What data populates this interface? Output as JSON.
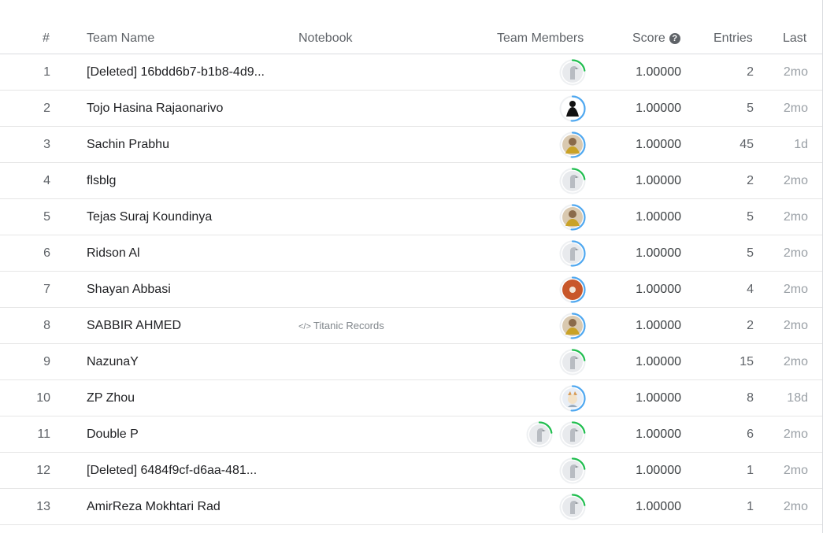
{
  "headers": {
    "rank": "#",
    "team_name": "Team Name",
    "notebook": "Notebook",
    "team_members": "Team Members",
    "score": "Score",
    "entries": "Entries",
    "last": "Last"
  },
  "colors": {
    "ring_green": "#20BE4F",
    "ring_blue": "#4FA8F0",
    "default_avatar": "#9aa0a6"
  },
  "rows": [
    {
      "rank": "1",
      "team": "[Deleted] 16bdd6b7-b1b8-4d9...",
      "notebook": "",
      "members": [
        {
          "icon": "goose-avatar-icon",
          "ring": "green"
        }
      ],
      "score": "1.00000",
      "entries": "2",
      "last": "2mo"
    },
    {
      "rank": "2",
      "team": "Tojo Hasina Rajaonarivo",
      "notebook": "",
      "members": [
        {
          "icon": "silhouette-avatar-icon",
          "ring": "blue"
        }
      ],
      "score": "1.00000",
      "entries": "5",
      "last": "2mo"
    },
    {
      "rank": "3",
      "team": "Sachin Prabhu",
      "notebook": "",
      "members": [
        {
          "icon": "photo-avatar-icon",
          "ring": "blue"
        }
      ],
      "score": "1.00000",
      "entries": "45",
      "last": "1d"
    },
    {
      "rank": "4",
      "team": "flsblg",
      "notebook": "",
      "members": [
        {
          "icon": "goose-avatar-icon",
          "ring": "green"
        }
      ],
      "score": "1.00000",
      "entries": "2",
      "last": "2mo"
    },
    {
      "rank": "5",
      "team": "Tejas Suraj Koundinya",
      "notebook": "",
      "members": [
        {
          "icon": "photo-avatar-icon",
          "ring": "blue"
        }
      ],
      "score": "1.00000",
      "entries": "5",
      "last": "2mo"
    },
    {
      "rank": "6",
      "team": "Ridson Al",
      "notebook": "",
      "members": [
        {
          "icon": "goose-avatar-icon",
          "ring": "blue"
        }
      ],
      "score": "1.00000",
      "entries": "5",
      "last": "2mo"
    },
    {
      "rank": "7",
      "team": "Shayan Abbasi",
      "notebook": "",
      "members": [
        {
          "icon": "orange-avatar-icon",
          "ring": "blue"
        }
      ],
      "score": "1.00000",
      "entries": "4",
      "last": "2mo"
    },
    {
      "rank": "8",
      "team": "SABBIR AHMED",
      "notebook": "Titanic Records",
      "members": [
        {
          "icon": "photo-avatar-icon",
          "ring": "blue"
        }
      ],
      "score": "1.00000",
      "entries": "2",
      "last": "2mo"
    },
    {
      "rank": "9",
      "team": "NazunaY",
      "notebook": "",
      "members": [
        {
          "icon": "goose-avatar-icon",
          "ring": "green"
        }
      ],
      "score": "1.00000",
      "entries": "15",
      "last": "2mo"
    },
    {
      "rank": "10",
      "team": "ZP Zhou",
      "notebook": "",
      "members": [
        {
          "icon": "cartoon-avatar-icon",
          "ring": "blue"
        }
      ],
      "score": "1.00000",
      "entries": "8",
      "last": "18d"
    },
    {
      "rank": "11",
      "team": "Double P",
      "notebook": "",
      "members": [
        {
          "icon": "goose-avatar-icon",
          "ring": "green"
        },
        {
          "icon": "goose-avatar-icon",
          "ring": "green"
        }
      ],
      "score": "1.00000",
      "entries": "6",
      "last": "2mo"
    },
    {
      "rank": "12",
      "team": "[Deleted] 6484f9cf-d6aa-481...",
      "notebook": "",
      "members": [
        {
          "icon": "goose-avatar-icon",
          "ring": "green"
        }
      ],
      "score": "1.00000",
      "entries": "1",
      "last": "2mo"
    },
    {
      "rank": "13",
      "team": "AmirReza Mokhtari Rad",
      "notebook": "",
      "members": [
        {
          "icon": "goose-avatar-icon",
          "ring": "green"
        }
      ],
      "score": "1.00000",
      "entries": "1",
      "last": "2mo"
    }
  ]
}
